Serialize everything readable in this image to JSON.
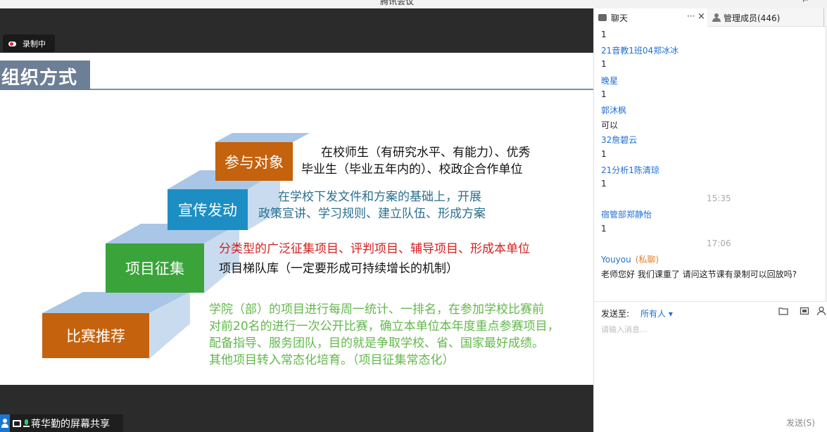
{
  "window": {
    "title": "腾讯会议"
  },
  "recording": {
    "label": "录制中"
  },
  "slide": {
    "title": "组织方式",
    "steps": [
      {
        "label": "参与对象",
        "color": "#c5620d",
        "lines": [
          "在校师生（有研究水平、有能力）、优秀",
          "毕业生（毕业五年内的）、校政企合作单位"
        ],
        "text_color": "#111111"
      },
      {
        "label": "宣传发动",
        "color": "#1d8ec4",
        "lines": [
          "在学校下发文件和方案的基础上，开展",
          "政策宣讲、学习规则、建立队伍、形成方案"
        ],
        "text_color": "#2a6f8f"
      },
      {
        "label": "项目征集",
        "color": "#3aa33a",
        "lines": [
          "分类型的广泛征集项目、评判项目、辅导项目、形成本单位",
          "项目梯队库（一定要形成可持续增长的机制）"
        ],
        "text_color": "#d42020",
        "text_color_2": "#111111"
      },
      {
        "label": "比赛推荐",
        "color": "#c5620d",
        "lines": [
          "学院（部）的项目进行每周一统计、一排名，在参加学校比赛前",
          "对前20名的进行一次公开比赛，确立本单位本年度重点参赛项目，",
          "配备指导、服务团队，目的就是争取学校、省、国家最好成绩。",
          "其他项目转入常态化培育。（项目征集常态化）"
        ],
        "text_color": "#62b84a"
      }
    ]
  },
  "share_status": {
    "label": "蒋华勤的屏幕共享"
  },
  "chat": {
    "tab_chat": "聊天",
    "tab_more": "···",
    "tab_close": "×",
    "tab_members": "管理成员(446)",
    "messages": [
      {
        "type": "body",
        "text": "1"
      },
      {
        "type": "sender",
        "text": "21音教1班04郑冰冰"
      },
      {
        "type": "body",
        "text": "1"
      },
      {
        "type": "sender",
        "text": "晚星"
      },
      {
        "type": "body",
        "text": "1"
      },
      {
        "type": "sender",
        "text": "郭沐枫"
      },
      {
        "type": "body",
        "text": "可以"
      },
      {
        "type": "sender",
        "text": "32詹碧云"
      },
      {
        "type": "body",
        "text": "1"
      },
      {
        "type": "sender",
        "text": "21分析1陈清琼"
      },
      {
        "type": "body",
        "text": "1"
      },
      {
        "type": "time",
        "text": "15:35"
      },
      {
        "type": "sender",
        "text": "宿管部郑静怡"
      },
      {
        "type": "body",
        "text": "1"
      },
      {
        "type": "time",
        "text": "17:06"
      },
      {
        "type": "sender_private",
        "text": "Youyou",
        "private_label": "(私聊)"
      },
      {
        "type": "body",
        "text": "老师您好 我们课重了 请问这节课有录制可以回放吗?"
      }
    ],
    "send_to_label": "发送至:",
    "send_to_value": "所有人 ▾",
    "input_placeholder": "请输入消息...",
    "send_button": "发送(S)"
  },
  "icons": [
    "cloud-record-icon",
    "chat-icon",
    "member-icon",
    "folder-icon",
    "screenshot-icon",
    "person-icon",
    "screen-share-icon",
    "mic-icon"
  ]
}
